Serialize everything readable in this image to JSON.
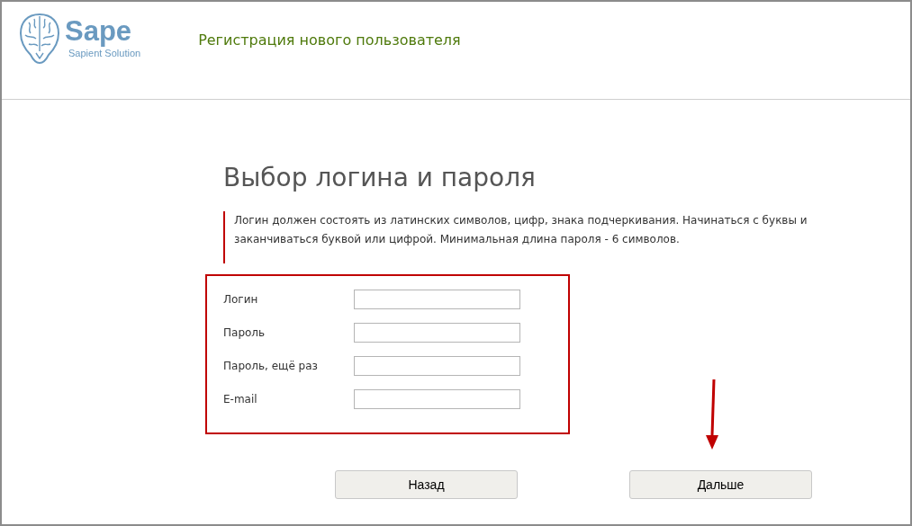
{
  "header": {
    "logo": {
      "name": "Sape",
      "tagline": "Sapient Solution"
    },
    "title": "Регистрация нового пользователя"
  },
  "heading": "Выбор логина и пароля",
  "note": "Логин должен состоять из латинских символов, цифр, знака подчеркивания. Начинаться с буквы и заканчиваться буквой или цифрой. Минимальная длина пароля - 6 символов.",
  "fields": [
    {
      "label": "Логин"
    },
    {
      "label": "Пароль"
    },
    {
      "label": "Пароль, ещё раз"
    },
    {
      "label": "E-mail"
    }
  ],
  "buttons": [
    {
      "label": "Назад"
    },
    {
      "label": "Дальше"
    }
  ]
}
